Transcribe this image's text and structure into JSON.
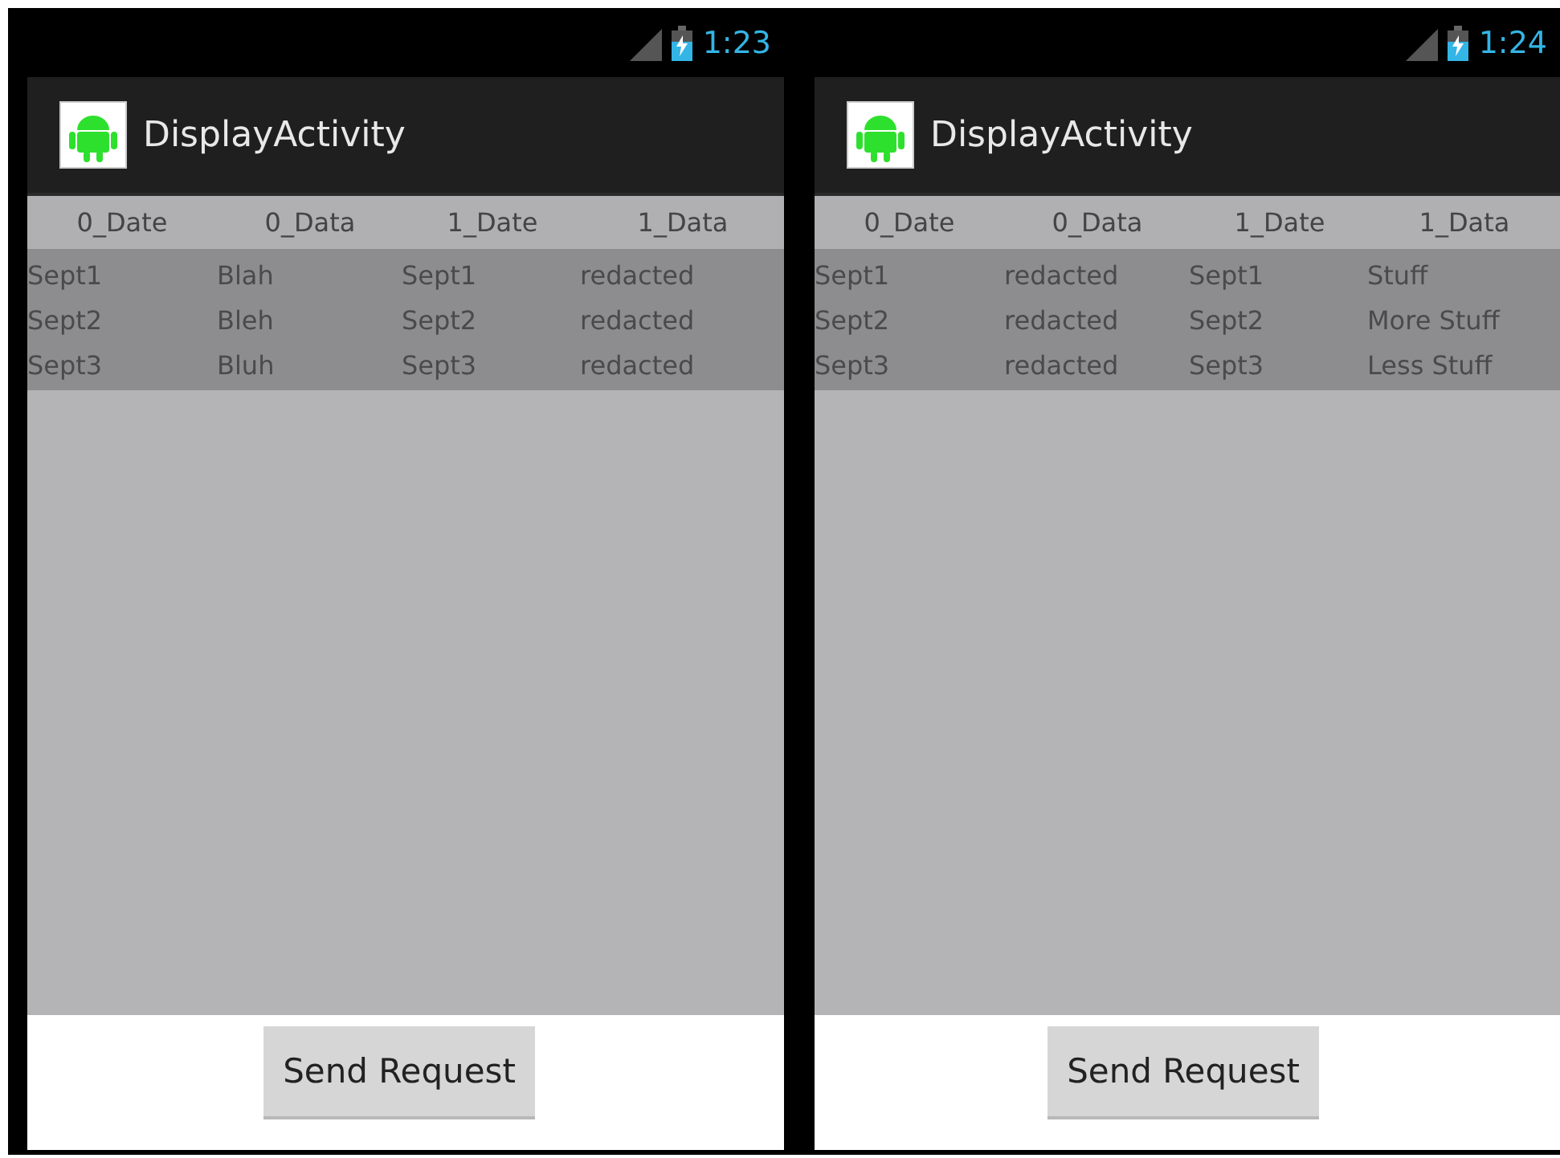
{
  "screens": [
    {
      "status_bar": {
        "time": "1:23"
      },
      "action_bar": {
        "title": "DisplayActivity"
      },
      "table": {
        "columns": [
          "0_Date",
          "0_Data",
          "1_Date",
          "1_Data"
        ],
        "rows": [
          [
            "Sept1",
            "Blah",
            "Sept1",
            "redacted"
          ],
          [
            "Sept2",
            "Bleh",
            "Sept2",
            "redacted"
          ],
          [
            "Sept3",
            "Bluh",
            "Sept3",
            "redacted"
          ]
        ]
      },
      "button": "Send Request"
    },
    {
      "status_bar": {
        "time": "1:24"
      },
      "action_bar": {
        "title": "DisplayActivity"
      },
      "table": {
        "columns": [
          "0_Date",
          "0_Data",
          "1_Date",
          "1_Data"
        ],
        "rows": [
          [
            "Sept1",
            "redacted",
            "Sept1",
            "Stuff"
          ],
          [
            "Sept2",
            "redacted",
            "Sept2",
            "More Stuff"
          ],
          [
            "Sept3",
            "redacted",
            "Sept3",
            "Less Stuff"
          ]
        ]
      },
      "button": "Send Request"
    }
  ]
}
